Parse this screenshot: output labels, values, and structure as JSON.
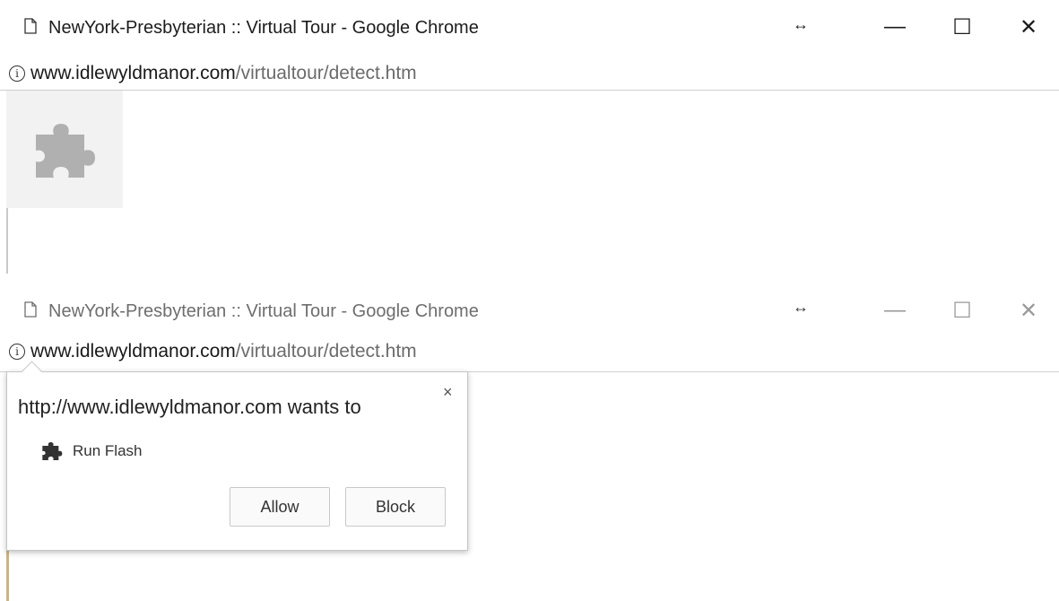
{
  "top_window": {
    "title": "NewYork-Presbyterian :: Virtual Tour - Google Chrome",
    "resize_glyph": "↔",
    "minimize_glyph": "—",
    "maximize_glyph": "☐",
    "close_glyph": "✕",
    "url_host": "www.idlewyldmanor.com",
    "url_path": "/virtualtour/detect.htm",
    "plugin_icon": "puzzle-piece-icon"
  },
  "bottom_window": {
    "title": "NewYork-Presbyterian :: Virtual Tour - Google Chrome",
    "resize_glyph": "↔",
    "minimize_glyph": "—",
    "maximize_glyph": "☐",
    "close_glyph": "✕",
    "url_host": "www.idlewyldmanor.com",
    "url_path": "/virtualtour/detect.htm"
  },
  "permission_popup": {
    "heading": "http://www.idlewyldmanor.com wants to",
    "close_glyph": "×",
    "permission_label": "Run Flash",
    "permission_icon": "puzzle-piece-icon",
    "allow_label": "Allow",
    "block_label": "Block"
  },
  "colors": {
    "plugin_placeholder_bg": "#f2f2f2",
    "plugin_icon": "#b0b0b0",
    "popup_border": "#c6c6c6"
  }
}
